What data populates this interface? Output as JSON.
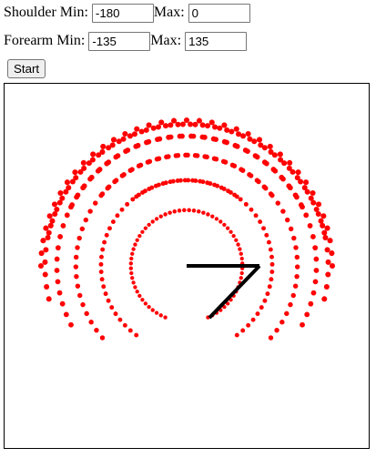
{
  "controls": {
    "shoulder_label": "Shoulder Min:",
    "shoulder_min": "-180",
    "shoulder_max_label": "Max:",
    "shoulder_max": "0",
    "forearm_label": "Forearm Min:",
    "forearm_min": "-135",
    "forearm_max_label": "Max:",
    "forearm_max": "135",
    "start_label": "Start"
  },
  "canvas": {
    "point_color": "#ff0000",
    "arm_color": "#000000"
  }
}
